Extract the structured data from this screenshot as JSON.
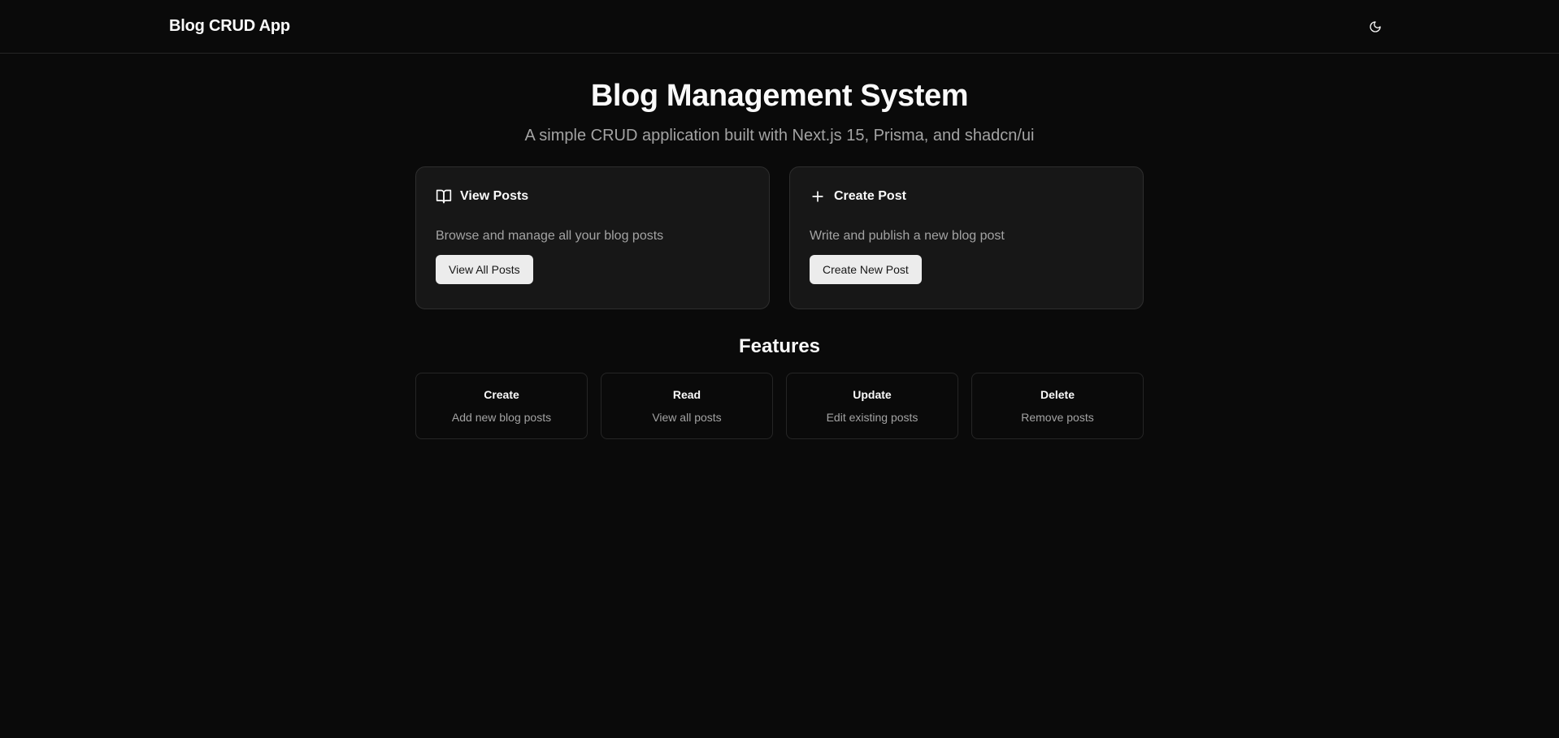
{
  "header": {
    "brand": "Blog CRUD App",
    "theme_icon": "moon-icon"
  },
  "hero": {
    "title": "Blog Management System",
    "subtitle": "A simple CRUD application built with Next.js 15, Prisma, and shadcn/ui"
  },
  "actions": [
    {
      "icon": "book-open-icon",
      "title": "View Posts",
      "description": "Browse and manage all your blog posts",
      "button": "View All Posts"
    },
    {
      "icon": "plus-icon",
      "title": "Create Post",
      "description": "Write and publish a new blog post",
      "button": "Create New Post"
    }
  ],
  "features": {
    "title": "Features",
    "items": [
      {
        "title": "Create",
        "description": "Add new blog posts"
      },
      {
        "title": "Read",
        "description": "View all posts"
      },
      {
        "title": "Update",
        "description": "Edit existing posts"
      },
      {
        "title": "Delete",
        "description": "Remove posts"
      }
    ]
  },
  "colors": {
    "background": "#0a0a0a",
    "card": "#171717",
    "border": "#262626",
    "muted_text": "#a3a3a3",
    "button_bg": "#ececec"
  }
}
